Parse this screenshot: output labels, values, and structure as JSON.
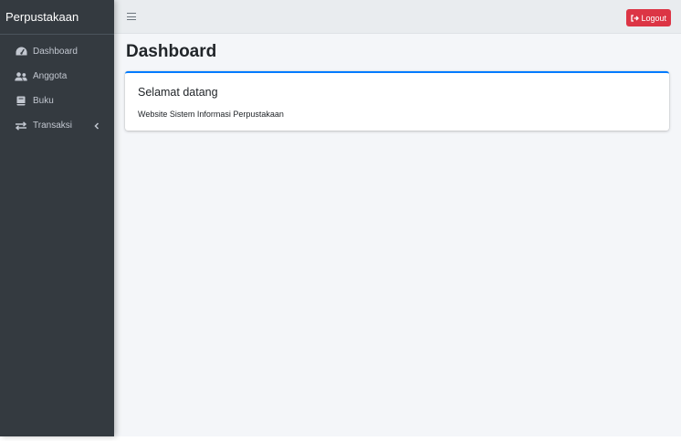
{
  "brand": {
    "title": "Perpustakaan"
  },
  "sidebar": {
    "items": [
      {
        "label": "Dashboard",
        "icon": "tachometer-icon"
      },
      {
        "label": "Anggota",
        "icon": "users-icon"
      },
      {
        "label": "Buku",
        "icon": "book-icon"
      },
      {
        "label": "Transaksi",
        "icon": "exchange-icon",
        "has_submenu": true
      }
    ]
  },
  "topbar": {
    "menu_icon": "hamburger-icon",
    "logout_label": "Logout",
    "logout_color": "#dc3545"
  },
  "main": {
    "page_title": "Dashboard",
    "card": {
      "title": "Selamat datang",
      "text": "Website Sistem Informasi Perpustakaan",
      "accent": "#007bff"
    }
  },
  "colors": {
    "sidebar_bg": "#343a40",
    "topbar_bg": "#e9ecef",
    "content_bg": "#f4f6f9"
  }
}
